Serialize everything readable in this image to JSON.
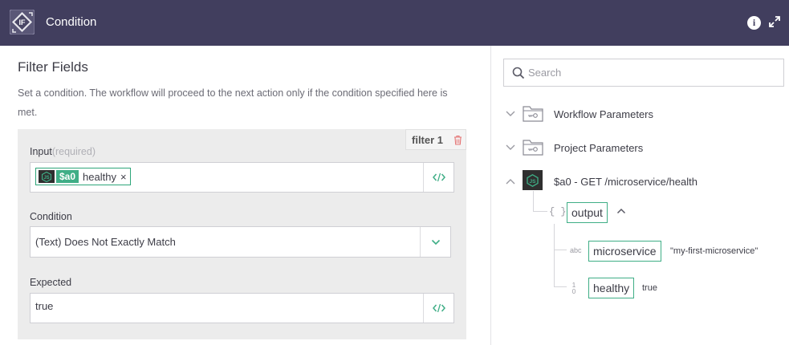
{
  "header": {
    "title": "Condition",
    "app_icon": "if-condition-icon",
    "icons": [
      "info-icon",
      "expand-icon"
    ],
    "background": "#413e5e"
  },
  "left": {
    "title": "Filter Fields",
    "description": "Set a condition. The workflow will proceed to the next action only if the condition specified here is met.",
    "filter_tag": "filter 1",
    "input": {
      "label": "Input",
      "required": "(required)",
      "token_var": "$a0",
      "token_text": "healthy",
      "token_remove": "×"
    },
    "condition": {
      "label": "Condition",
      "value": "(Text) Does Not Exactly Match"
    },
    "expected": {
      "label": "Expected",
      "value": "true"
    }
  },
  "right": {
    "search": {
      "placeholder": "Search"
    },
    "tree": [
      {
        "label": "Workflow Parameters",
        "expanded": false,
        "icon": "folder-key-icon"
      },
      {
        "label": "Project Parameters",
        "expanded": false,
        "icon": "folder-key-icon"
      },
      {
        "label": "$a0 - GET /microservice/health",
        "expanded": true,
        "icon": "nodejs-icon"
      }
    ],
    "output": {
      "braces": "{ }",
      "key": "output",
      "children": [
        {
          "type": "abc",
          "key": "microservice",
          "value": "\"my-first-microservice\""
        },
        {
          "type_top": "1",
          "type_bottom": "0",
          "key": "healthy",
          "value": "true"
        }
      ]
    }
  },
  "colors": {
    "accent": "#3fae86",
    "header": "#413e5e",
    "trash": "#e57373"
  }
}
